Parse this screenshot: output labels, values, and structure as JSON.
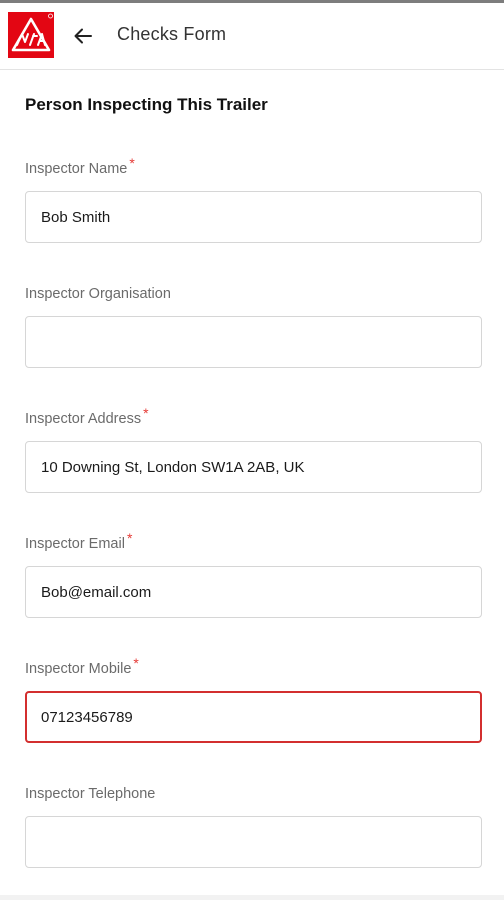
{
  "header": {
    "title": "Checks Form",
    "logo_text": "NTTA",
    "logo_color": "#e30613"
  },
  "form": {
    "section_title": "Person Inspecting This Trailer",
    "required_marker": "*",
    "fields": [
      {
        "label": "Inspector Name",
        "required": true,
        "value": "Bob Smith"
      },
      {
        "label": "Inspector Organisation",
        "required": false,
        "value": ""
      },
      {
        "label": "Inspector Address",
        "required": true,
        "value": "10 Downing St, London SW1A 2AB, UK"
      },
      {
        "label": "Inspector Email",
        "required": true,
        "value": "Bob@email.com"
      },
      {
        "label": "Inspector Mobile",
        "required": true,
        "value": "07123456789",
        "state": "error"
      },
      {
        "label": "Inspector Telephone",
        "required": false,
        "value": ""
      }
    ]
  },
  "colors": {
    "accent": "#e30613",
    "error_border": "#d32f2f",
    "required_marker": "#e53935"
  }
}
